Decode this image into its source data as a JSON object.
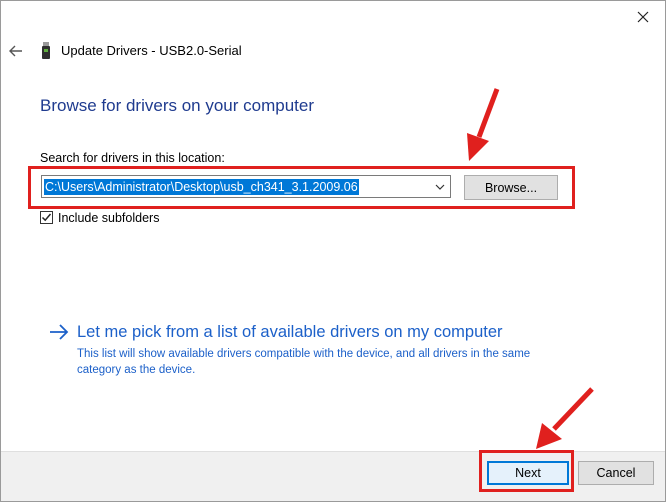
{
  "window": {
    "title": "Update Drivers - USB2.0-Serial",
    "close_icon": "close-icon",
    "back_icon": "back-arrow-icon",
    "device_icon": "usb-device-icon"
  },
  "main": {
    "heading": "Browse for drivers on your computer",
    "location_label": "Search for drivers in this location:",
    "path_value": "C:\\Users\\Administrator\\Desktop\\usb_ch341_3.1.2009.06",
    "browse_label": "Browse...",
    "include_subfolders": {
      "label": "Include subfolders",
      "checked": true
    },
    "pick_link": {
      "title": "Let me pick from a list of available drivers on my computer",
      "description": "This list will show available drivers compatible with the device, and all drivers in the same category as the device."
    }
  },
  "footer": {
    "next_label": "Next",
    "cancel_label": "Cancel"
  },
  "colors": {
    "accent": "#0078d7",
    "heading": "#1f3b8f",
    "link": "#1c60c9",
    "annotation": "#e0201e"
  }
}
